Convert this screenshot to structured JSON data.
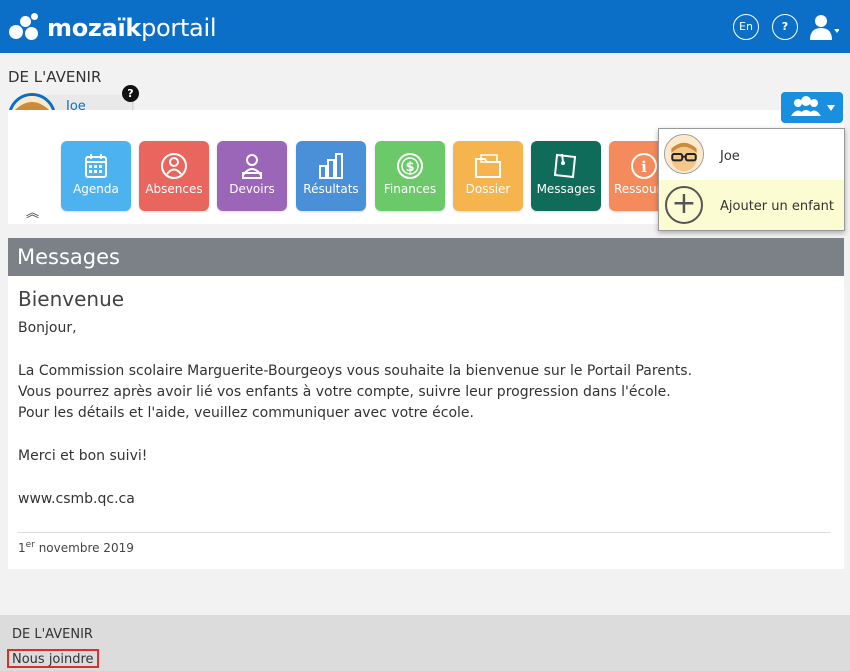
{
  "header": {
    "logo_bold": "mozaïk",
    "logo_light": "portail",
    "lang_button": "En",
    "help_button": "?",
    "user_icon": "user-icon",
    "brand_color": "#0b6fc8"
  },
  "school": {
    "name": "DE L'AVENIR"
  },
  "child": {
    "name": "Joe",
    "help_badge": "?"
  },
  "tiles": [
    {
      "label": "Agenda",
      "icon": "calendar-icon",
      "color": "#4db3f0"
    },
    {
      "label": "Absences",
      "icon": "absence-person-icon",
      "color": "#e8665e"
    },
    {
      "label": "Devoirs",
      "icon": "homework-person-icon",
      "color": "#9b65b8"
    },
    {
      "label": "Résultats",
      "icon": "bar-chart-icon",
      "color": "#4a90d9"
    },
    {
      "label": "Finances",
      "icon": "dollar-icon",
      "color": "#6cc96a"
    },
    {
      "label": "Dossier",
      "icon": "folder-icon",
      "color": "#f5b44d"
    },
    {
      "label": "Messages",
      "icon": "message-icon",
      "color": "#0f6b5a"
    },
    {
      "label": "Ressour",
      "icon": "resources-icon",
      "color": "#f58b5c"
    }
  ],
  "collapse_glyph": "︽",
  "family_menu": {
    "button_icon": "family-icon",
    "items": [
      {
        "label": "Joe"
      },
      {
        "label": "Ajouter un enfant",
        "glyph": "+"
      }
    ]
  },
  "messages": {
    "section_title": "Messages",
    "title": "Bienvenue",
    "lines": [
      "Bonjour,",
      "La Commission scolaire Marguerite-Bourgeoys vous souhaite la bienvenue sur le Portail Parents.",
      "Vous pourrez après avoir lié vos enfants à votre compte, suivre leur progression dans l'école.",
      "Pour les détails et l'aide, veuillez communiquer avec votre école.",
      "Merci et bon suivi!",
      "www.csmb.qc.ca"
    ],
    "date_day": "1",
    "date_sup": "er",
    "date_rest": " novembre 2019"
  },
  "footer": {
    "school": "DE L'AVENIR",
    "contact_link": "Nous joindre"
  }
}
